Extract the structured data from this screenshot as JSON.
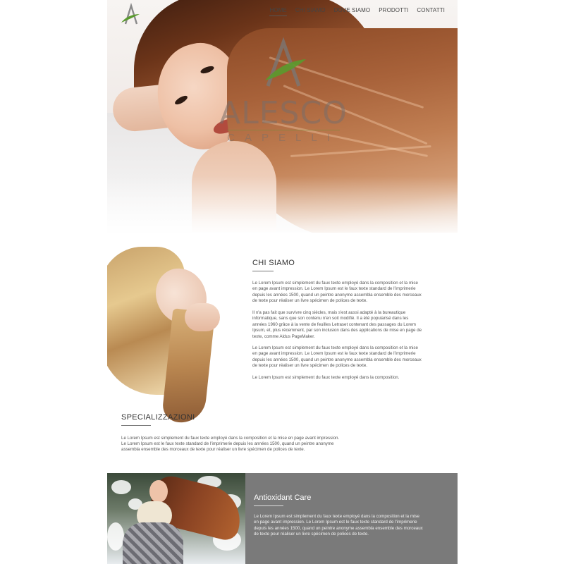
{
  "nav": {
    "items": [
      {
        "label": "HOME",
        "active": true
      },
      {
        "label": "CHI SIAMO",
        "active": false
      },
      {
        "label": "DOVE SIAMO",
        "active": false
      },
      {
        "label": "PRODOTTI",
        "active": false
      },
      {
        "label": "CONTATTI",
        "active": false
      }
    ]
  },
  "hero": {
    "brand": "ALESCO",
    "brand_sub": "CAPELLI"
  },
  "about": {
    "title": "CHI SIAMO",
    "paragraphs": [
      "Le Lorem Ipsum est simplement du faux texte employé dans la composition et la mise en page avant impression. Le Lorem Ipsum est le faux texte standard de l'imprimerie depuis les années 1500, quand un peintre anonyme assembla ensemble des morceaux de texte pour réaliser un livre spécimen de polices de texte.",
      "Il n'a pas fait que survivre cinq siècles, mais s'est aussi adapté à la bureautique informatique, sans que son contenu n'en soit modifié. Il a été popularisé dans les années 1960 grâce à la vente de feuilles Letraset contenant des passages du Lorem Ipsum, et, plus récemment, par son inclusion dans des applications de mise en page de texte, comme Aldus PageMaker.",
      "Le Lorem Ipsum est simplement du faux texte employé dans la composition et la mise en page avant impression. Le Lorem Ipsum est le faux texte standard de l'imprimerie depuis les années 1500, quand un peintre anonyme assembla ensemble des morceaux de texte pour réaliser un livre spécimen de polices de texte.",
      "Le Lorem Ipsum est simplement du faux texte employé dans la composition."
    ]
  },
  "specs": {
    "title": "SPECIALIZZAZIONI",
    "lines": [
      "Le Lorem Ipsum est simplement du faux texte employé dans la composition et la mise en page avant impression.",
      "Le Lorem Ipsum est le faux texte standard de l'imprimerie depuis les années 1500, quand un peintre anonyme",
      "assembla ensemble des morceaux de texte pour réaliser un livre spécimen de polices de texte."
    ]
  },
  "antioxidant": {
    "title": "Antioxidant Care",
    "paragraph": "Le Lorem Ipsum est simplement du faux texte employé dans la composition et la mise en page avant impression. Le Lorem Ipsum est le faux texte standard de l'imprimerie depuis les années 1500, quand un peintre anonyme assembla ensemble des morceaux de texte pour réaliser un livre spécimen de polices de texte."
  },
  "colors": {
    "leaf_green": "#5a9a2e",
    "logo_gray": "#8a8a8a",
    "panel_gray": "#7a7a7a"
  }
}
